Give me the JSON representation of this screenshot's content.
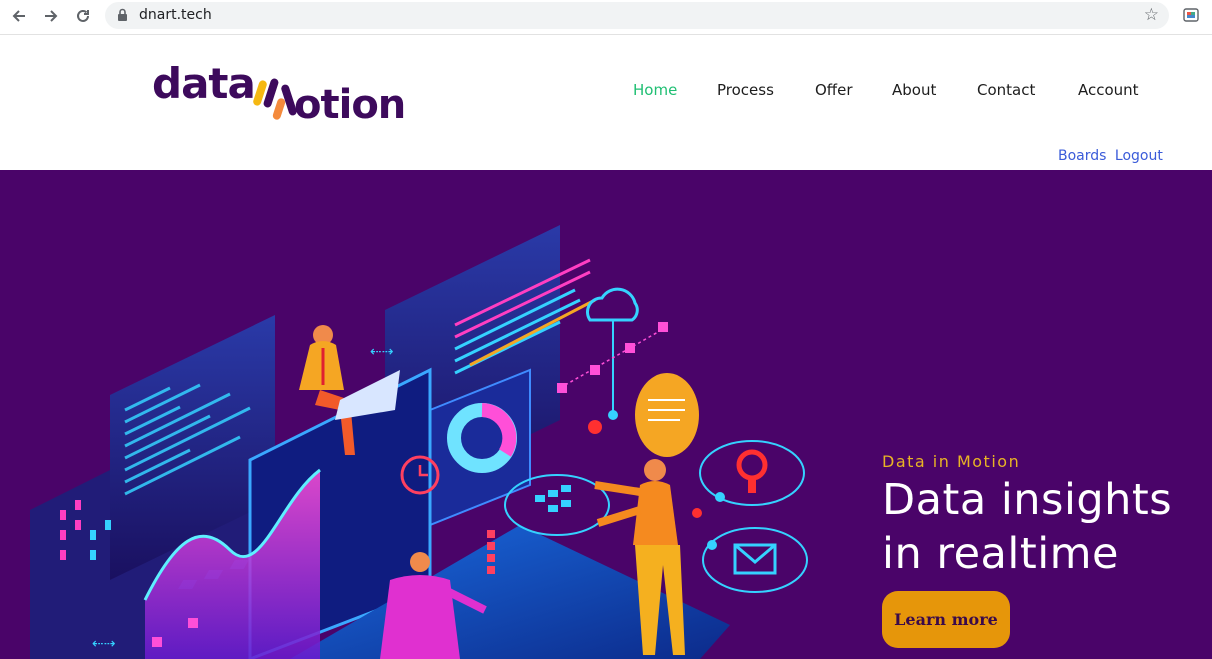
{
  "browser": {
    "url": "dnart.tech",
    "back_icon": "arrow-left-icon",
    "forward_icon": "arrow-right-icon",
    "reload_icon": "reload-icon",
    "lock_icon": "lock-icon",
    "bookmark_icon": "star-icon"
  },
  "site": {
    "logo_text": "dataInMotion",
    "nav": [
      {
        "label": "Home",
        "active": true
      },
      {
        "label": "Process",
        "active": false
      },
      {
        "label": "Offer",
        "active": false
      },
      {
        "label": "About",
        "active": false
      },
      {
        "label": "Contact",
        "active": false
      },
      {
        "label": "Account",
        "active": false
      }
    ],
    "sub_links": [
      "Boards",
      "Logout"
    ]
  },
  "hero": {
    "eyebrow": "Data in Motion",
    "headline_line1": "Data insights",
    "headline_line2": "in realtime",
    "cta_label": "Learn more"
  },
  "colors": {
    "hero_bg": "#4a0469",
    "nav_active": "#1fbf73",
    "sub_link": "#3a5bd9",
    "cta_bg": "#e6960a",
    "eyebrow": "#e8b425",
    "logo_purple": "#3d0a5c",
    "logo_yellow": "#f5b812",
    "logo_orange": "#f48a3c"
  }
}
